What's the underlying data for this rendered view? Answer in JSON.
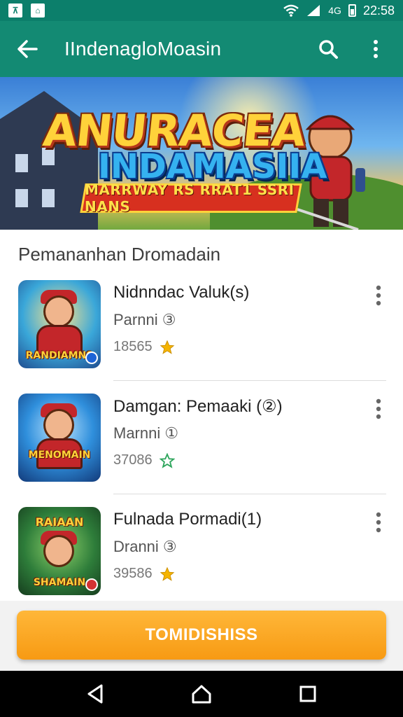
{
  "status_bar": {
    "left_icons": [
      "notification-a-icon",
      "notification-b-icon"
    ],
    "time": "22:58",
    "network_label": "4G"
  },
  "app_bar": {
    "title": "IIndenagloMoasin",
    "back_icon": "arrow-left-icon",
    "search_icon": "search-icon",
    "more_icon": "more-vertical-icon"
  },
  "banner": {
    "title": "ANURACEA",
    "subtitle": "INDAMASIIA",
    "ribbon": "MARRWAY RS RRAT1 SSRI NANS"
  },
  "section": {
    "title": "Pemananhan Dromadain"
  },
  "items": [
    {
      "title": "Nidnndac Valuk(s)",
      "subtitle": "Parnni ③",
      "count": "18565",
      "thumb_label": "RANDIAMNS",
      "thumb_top_label": "",
      "star_color": "#f5b400"
    },
    {
      "title": "Damgan: Pemaaki (②)",
      "subtitle": "Marnni ①",
      "count": "37086",
      "thumb_label": "MENOMAIN",
      "thumb_top_label": "",
      "star_color": "#2ea55c"
    },
    {
      "title": "Fulnada Pormadi(1)",
      "subtitle": "Dranni ③",
      "count": "39586",
      "thumb_label": "SHAMAIN",
      "thumb_top_label": "RAIAAN",
      "star_color": "#f5b400"
    }
  ],
  "cta": {
    "label": "TOMIDISHISS"
  },
  "colors": {
    "app_bar": "#138a73",
    "status_bar": "#0c7f6b",
    "cta": "#f79a13"
  }
}
